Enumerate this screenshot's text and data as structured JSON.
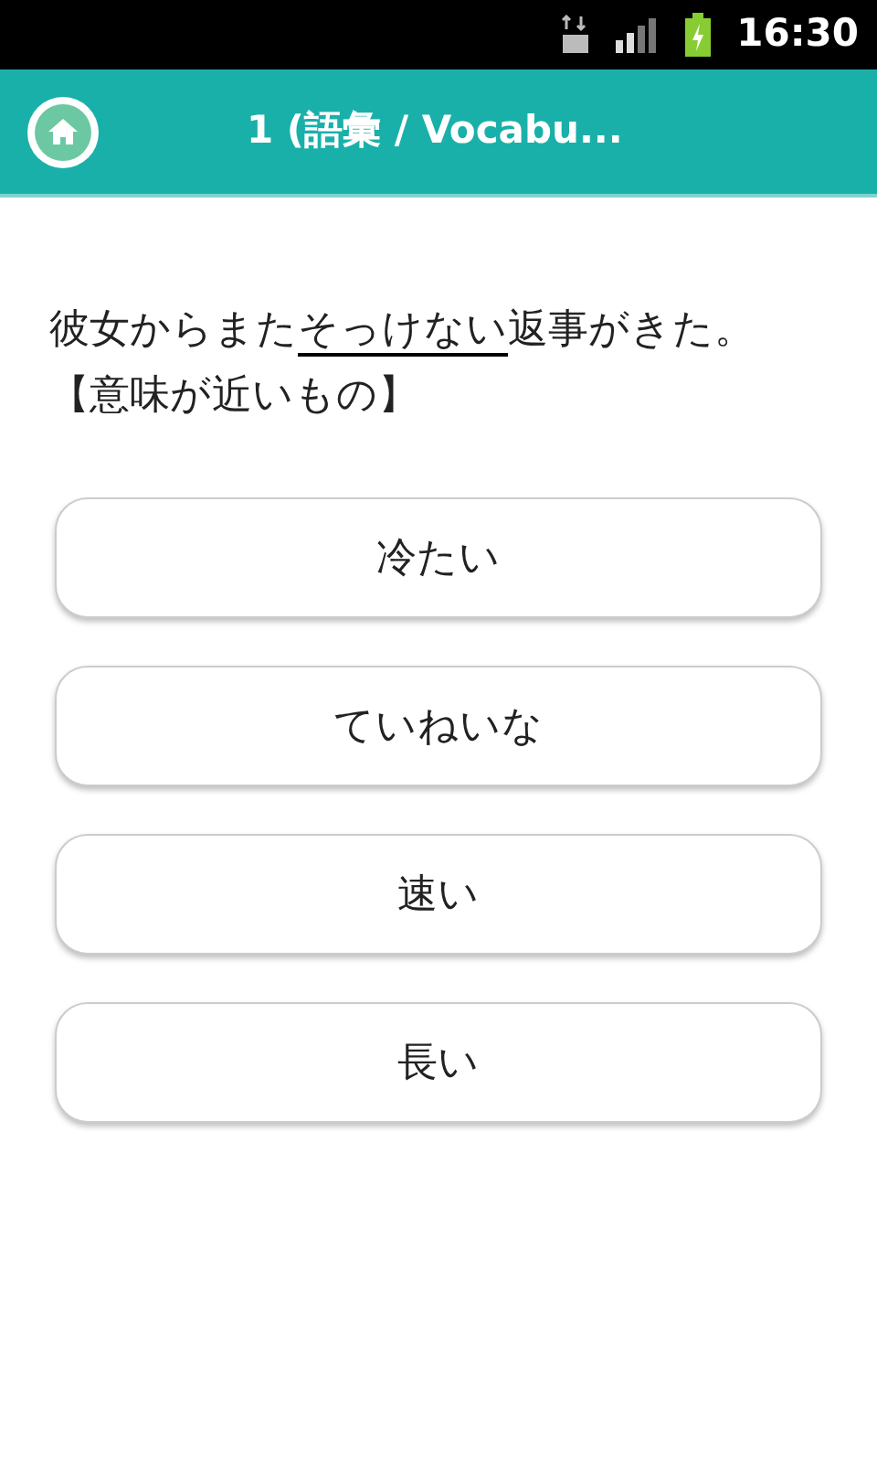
{
  "status_bar": {
    "time": "16:30"
  },
  "header": {
    "title": "1 (語彙 / Vocabu..."
  },
  "question": {
    "before": "彼女からまた",
    "underlined": "そっけない",
    "after": "返事がきた。",
    "instruction": "【意味が近いもの】"
  },
  "choices": [
    {
      "label": "冷たい"
    },
    {
      "label": "ていねいな"
    },
    {
      "label": "速い"
    },
    {
      "label": "長い"
    }
  ]
}
